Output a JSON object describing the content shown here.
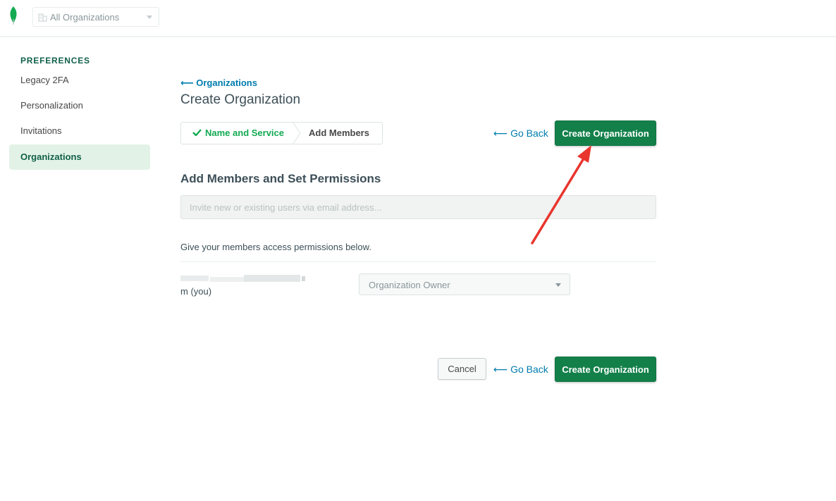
{
  "topbar": {
    "org_selector": {
      "label": "All Organizations"
    }
  },
  "sidebar": {
    "heading": "PREFERENCES",
    "items": [
      {
        "label": "Legacy 2FA",
        "active": false
      },
      {
        "label": "Personalization",
        "active": false
      },
      {
        "label": "Invitations",
        "active": false
      },
      {
        "label": "Organizations",
        "active": true
      }
    ]
  },
  "main": {
    "back_link": "Organizations",
    "title": "Create Organization",
    "steps": [
      {
        "label": "Name and Service",
        "completed": true
      },
      {
        "label": "Add Members",
        "completed": false
      }
    ],
    "go_back_label": "Go Back",
    "create_label": "Create Organization",
    "section_title": "Add Members and Set Permissions",
    "invite_placeholder": "Invite new or existing users via email address...",
    "permissions_note": "Give your members access permissions below.",
    "member": {
      "email_suffix": "m (you)",
      "role": "Organization Owner"
    },
    "cancel_label": "Cancel"
  },
  "colors": {
    "brand_green": "#13804a",
    "success_green": "#13aa52",
    "link_blue": "#007cad",
    "sidebar_active_bg": "#e3f2e7",
    "annotation_red": "#e8352e"
  }
}
